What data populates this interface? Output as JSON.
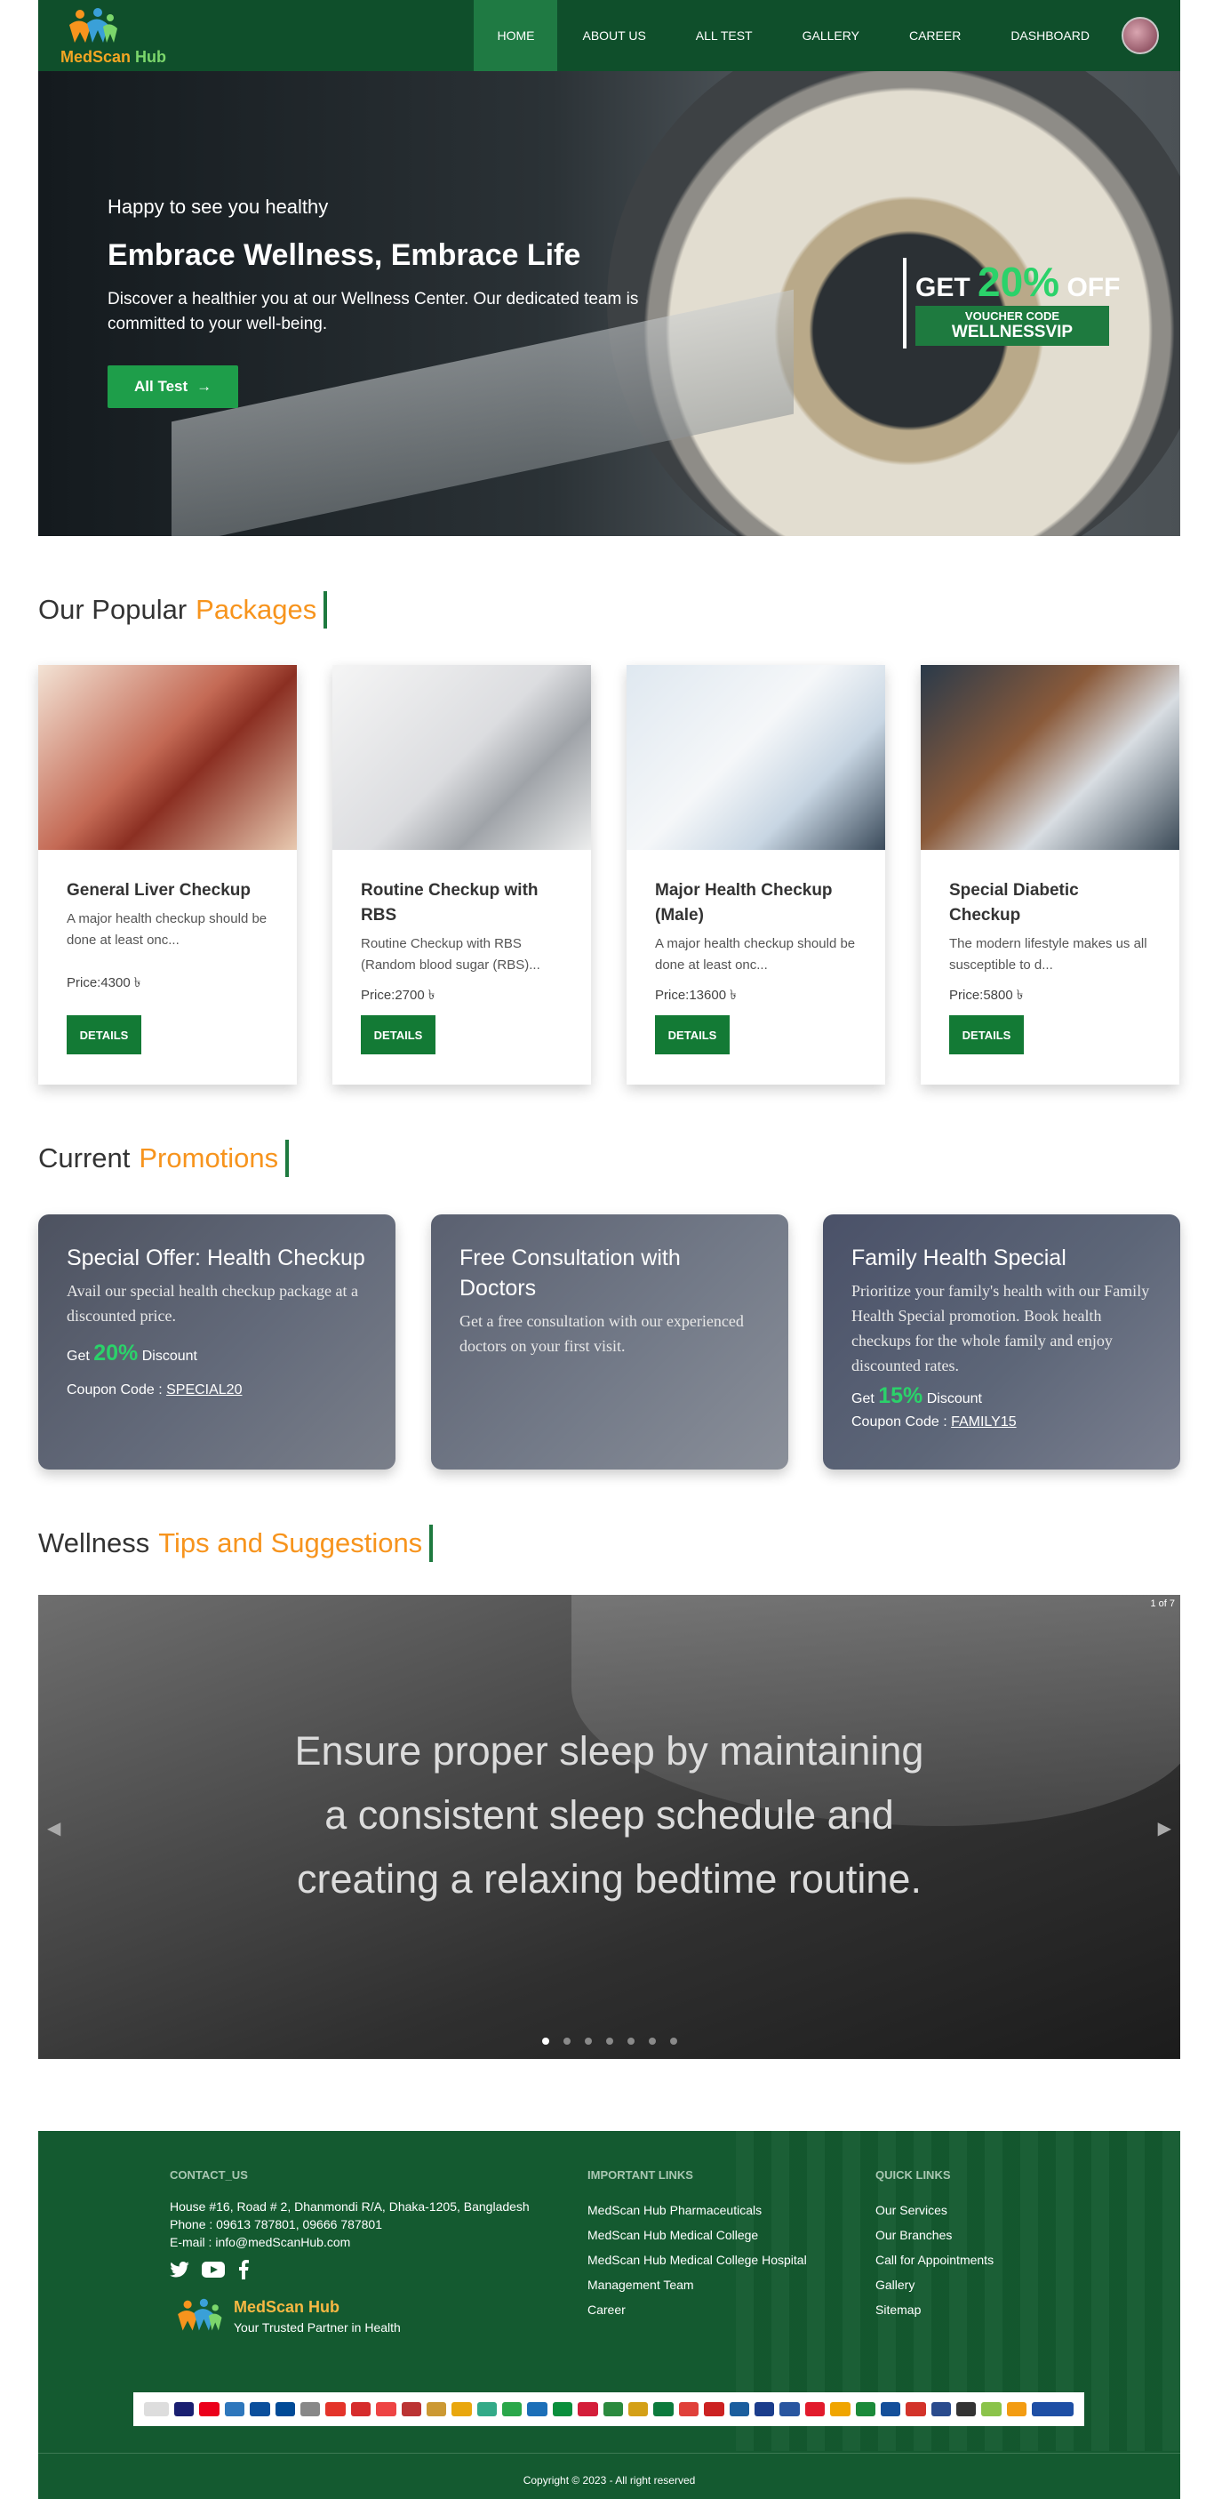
{
  "nav": {
    "brand": "MedScan",
    "brand_accent": "Hub",
    "items": [
      "HOME",
      "ABOUT US",
      "ALL TEST",
      "GALLERY",
      "CAREER",
      "DASHBOARD"
    ],
    "active": "HOME"
  },
  "hero": {
    "greeting": "Happy to see you healthy",
    "title": "Embrace Wellness, Embrace Life",
    "description": "Discover a healthier you at our Wellness Center. Our dedicated team is committed to your well-being.",
    "button": "All Test",
    "button_icon": "arrow-right-icon",
    "voucher": {
      "get": "GET",
      "percent": "20%",
      "off": "OFF",
      "label": "VOUCHER CODE",
      "code": "WELLNESSVIP"
    }
  },
  "packages": {
    "title_prefix": "Our Popular",
    "title_accent": "Packages",
    "items": [
      {
        "title": "General Liver Checkup",
        "desc": "A major health checkup should be done at least onc...",
        "price": "Price:4300 ৳",
        "button": "DETAILS"
      },
      {
        "title": "Routine Checkup with RBS",
        "desc": "Routine Checkup with RBS (Random blood sugar (RBS)...",
        "price": "Price:2700 ৳",
        "button": "DETAILS"
      },
      {
        "title": "Major Health Checkup (Male)",
        "desc": "A major health checkup should be done at least onc...",
        "price": "Price:13600 ৳",
        "button": "DETAILS"
      },
      {
        "title": "Special Diabetic Checkup",
        "desc": "The modern lifestyle makes us all susceptible to d...",
        "price": "Price:5800 ৳",
        "button": "DETAILS"
      }
    ]
  },
  "promotions": {
    "title_prefix": "Current",
    "title_accent": "Promotions",
    "items": [
      {
        "title": "Special Offer: Health Checkup",
        "desc": "Avail our special health checkup package at a discounted price.",
        "get": "Get",
        "percent": "20%",
        "discount": "Discount",
        "coupon_label": "Coupon Code :",
        "coupon": "SPECIAL20"
      },
      {
        "title": "Free Consultation with Doctors",
        "desc": "Get a free consultation with our experienced doctors on your first visit."
      },
      {
        "title": "Family Health Special",
        "desc": "Prioritize your family's health with our Family Health Special promotion. Book health checkups for the whole family and enjoy discounted rates.",
        "get": "Get",
        "percent": "15%",
        "discount": "Discount",
        "coupon_label": "Coupon Code :",
        "coupon": "FAMILY15"
      }
    ]
  },
  "tips": {
    "title_prefix": "Wellness",
    "title_accent": "Tips and Suggestions",
    "slide_text": "Ensure proper sleep by maintaining a consistent sleep schedule and creating a relaxing bedtime routine.",
    "counter": "1 of 7",
    "dots": 7,
    "active_dot": 1
  },
  "footer": {
    "contact": {
      "heading": "CONTACT_US",
      "address": "House #16, Road # 2, Dhanmondi R/A, Dhaka-1205, Bangladesh",
      "phone": "Phone : 09613 787801, 09666 787801",
      "email": "E-mail : info@medScanHub.com"
    },
    "important": {
      "heading": "IMPORTANT LINKS",
      "links": [
        "MedScan Hub Pharmaceuticals",
        "MedScan Hub Medical College",
        "MedScan Hub Medical College Hospital",
        "Management Team",
        "Career"
      ]
    },
    "quick": {
      "heading": "QUICK LINKS",
      "links": [
        "Our Services",
        "Our Branches",
        "Call for Appointments",
        "Gallery",
        "Sitemap"
      ]
    },
    "brand": "MedScan Hub",
    "tagline": "Your Trusted Partner in Health",
    "copyright": "Copyright © 2023 - All right reserved"
  }
}
